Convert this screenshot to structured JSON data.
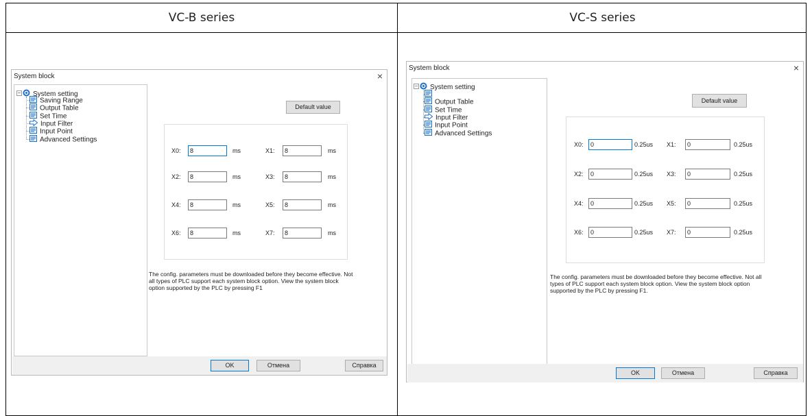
{
  "headers": {
    "left": "VC-B series",
    "right": "VC-S series"
  },
  "vcb": {
    "title": "System block",
    "close": "×",
    "tree": {
      "root": "System setting",
      "items": [
        "Saving Range",
        "Output Table",
        "Set Time",
        "Input Filter",
        "Input Point",
        "Advanced Settings"
      ]
    },
    "default_button": "Default value",
    "fields": [
      {
        "label": "X0:",
        "value": "8",
        "unit": "ms"
      },
      {
        "label": "X1:",
        "value": "8",
        "unit": "ms"
      },
      {
        "label": "X2:",
        "value": "8",
        "unit": "ms"
      },
      {
        "label": "X3:",
        "value": "8",
        "unit": "ms"
      },
      {
        "label": "X4:",
        "value": "8",
        "unit": "ms"
      },
      {
        "label": "X5:",
        "value": "8",
        "unit": "ms"
      },
      {
        "label": "X6:",
        "value": "8",
        "unit": "ms"
      },
      {
        "label": "X7:",
        "value": "8",
        "unit": "ms"
      }
    ],
    "note": "The config. parameters must be downloaded before they become effective. Not all types of PLC support each system block option. View the system block option supported by the PLC by pressing F1",
    "ok": "OK",
    "cancel": "Отмена",
    "help": "Справка"
  },
  "vcs": {
    "title": "System block",
    "close": "×",
    "tree": {
      "root": "System setting",
      "items": [
        "",
        "Output Table",
        "Set Time",
        "Input Filter",
        "Input Point",
        "Advanced Settings"
      ]
    },
    "default_button": "Default value",
    "fields": [
      {
        "label": "X0:",
        "value": "0",
        "unit": "0.25us"
      },
      {
        "label": "X1:",
        "value": "0",
        "unit": "0.25us"
      },
      {
        "label": "X2:",
        "value": "0",
        "unit": "0.25us"
      },
      {
        "label": "X3:",
        "value": "0",
        "unit": "0.25us"
      },
      {
        "label": "X4:",
        "value": "0",
        "unit": "0.25us"
      },
      {
        "label": "X5:",
        "value": "0",
        "unit": "0.25us"
      },
      {
        "label": "X6:",
        "value": "0",
        "unit": "0.25us"
      },
      {
        "label": "X7:",
        "value": "0",
        "unit": "0.25us"
      }
    ],
    "note": "The config. parameters must be downloaded before they become effective. Not all types of PLC support each system block option. View the system block option supported by the PLC by pressing F1.",
    "ok": "OK",
    "cancel": "Отмена",
    "help": "Справка"
  },
  "icons": {
    "root": "gear-icon",
    "item": "document-icon",
    "selected": "arrow-right-icon"
  },
  "colors": {
    "focus": "#0078d7",
    "icon": "#1e6fc8"
  }
}
